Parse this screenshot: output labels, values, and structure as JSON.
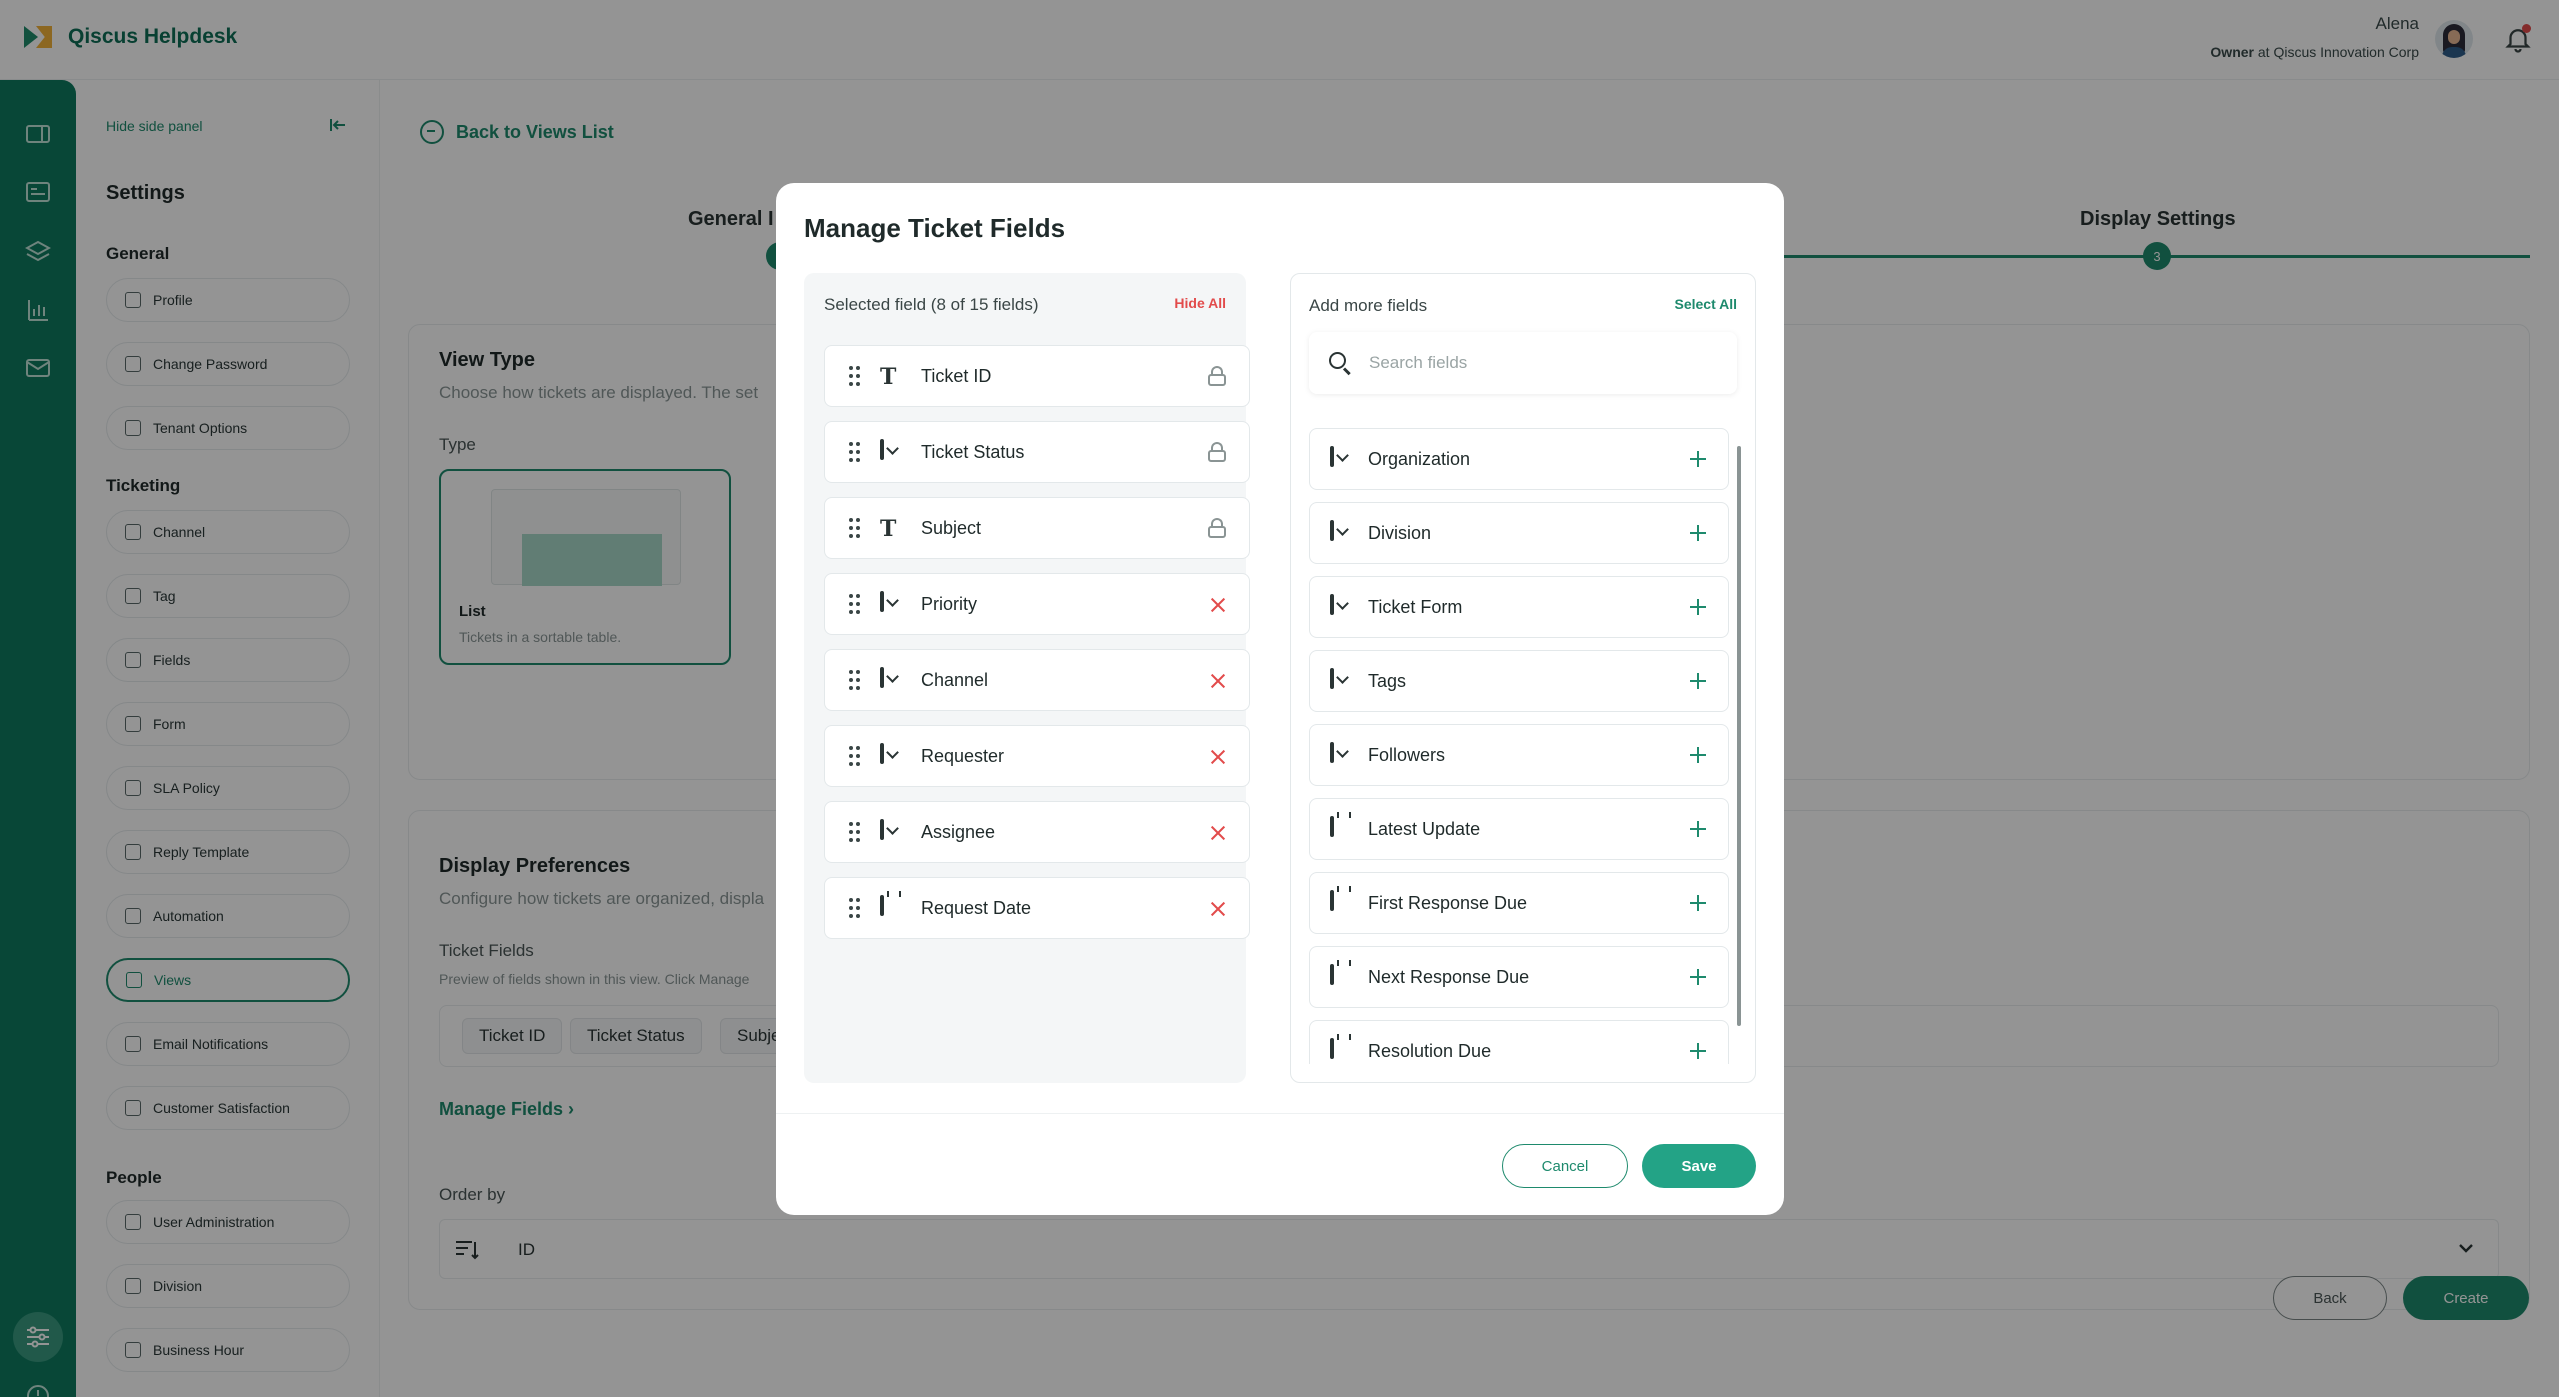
{
  "app": {
    "title": "Qiscus Helpdesk"
  },
  "user": {
    "name": "Alena",
    "role": "Owner",
    "company_sep": " at ",
    "company": "Qiscus Innovation Corp"
  },
  "sidepanel": {
    "hide_label": "Hide side panel",
    "title": "Settings",
    "groups": [
      {
        "title": "General",
        "items": [
          "Profile",
          "Change Password",
          "Tenant Options"
        ]
      },
      {
        "title": "Ticketing",
        "items": [
          "Channel",
          "Tag",
          "Fields",
          "Form",
          "SLA Policy",
          "Reply Template",
          "Automation",
          "Views",
          "Email Notifications",
          "Customer Satisfaction"
        ]
      },
      {
        "title": "People",
        "items": [
          "User Administration",
          "Division",
          "Business Hour"
        ]
      }
    ],
    "active_item": "Views"
  },
  "main": {
    "back_label": "Back to Views List",
    "steps": {
      "first": "General I",
      "third": "Display Settings",
      "third_number": "3"
    },
    "view_type": {
      "title": "View Type",
      "subtitle": "Choose how tickets are displayed. The set",
      "type_label": "Type",
      "option_title": "List",
      "option_desc": "Tickets in a sortable table."
    },
    "display_prefs": {
      "title": "Display Preferences",
      "subtitle": "Configure how tickets are organized, displa",
      "fields_label": "Ticket Fields",
      "fields_hint": "Preview of fields shown in this view. Click Manage",
      "chips": [
        "Ticket ID",
        "Ticket Status",
        "Subje"
      ],
      "manage_link": "Manage Fields",
      "order_label": "Order by",
      "order_value": "ID"
    },
    "buttons": {
      "back": "Back",
      "create": "Create"
    }
  },
  "modal": {
    "title": "Manage Ticket Fields",
    "selected": {
      "header": "Selected field (8 of 15 fields)",
      "action": "Hide All",
      "fields": [
        {
          "name": "Ticket ID",
          "type": "text",
          "locked": true
        },
        {
          "name": "Ticket Status",
          "type": "dropdown",
          "locked": true
        },
        {
          "name": "Subject",
          "type": "text",
          "locked": true
        },
        {
          "name": "Priority",
          "type": "dropdown",
          "locked": false
        },
        {
          "name": "Channel",
          "type": "dropdown",
          "locked": false
        },
        {
          "name": "Requester",
          "type": "dropdown",
          "locked": false
        },
        {
          "name": "Assignee",
          "type": "dropdown",
          "locked": false
        },
        {
          "name": "Request Date",
          "type": "date",
          "locked": false
        }
      ]
    },
    "available": {
      "header": "Add more fields",
      "action": "Select All",
      "search_placeholder": "Search fields",
      "fields": [
        {
          "name": "Organization",
          "type": "dropdown"
        },
        {
          "name": "Division",
          "type": "dropdown"
        },
        {
          "name": "Ticket Form",
          "type": "dropdown"
        },
        {
          "name": "Tags",
          "type": "dropdown"
        },
        {
          "name": "Followers",
          "type": "dropdown"
        },
        {
          "name": "Latest Update",
          "type": "date"
        },
        {
          "name": "First Response Due",
          "type": "date"
        },
        {
          "name": "Next Response Due",
          "type": "date"
        },
        {
          "name": "Resolution Due",
          "type": "date"
        }
      ]
    },
    "buttons": {
      "cancel": "Cancel",
      "save": "Save"
    }
  },
  "colors": {
    "brand": "#1e8a6d",
    "danger": "#e24b4b",
    "rail": "#0f7a60"
  }
}
